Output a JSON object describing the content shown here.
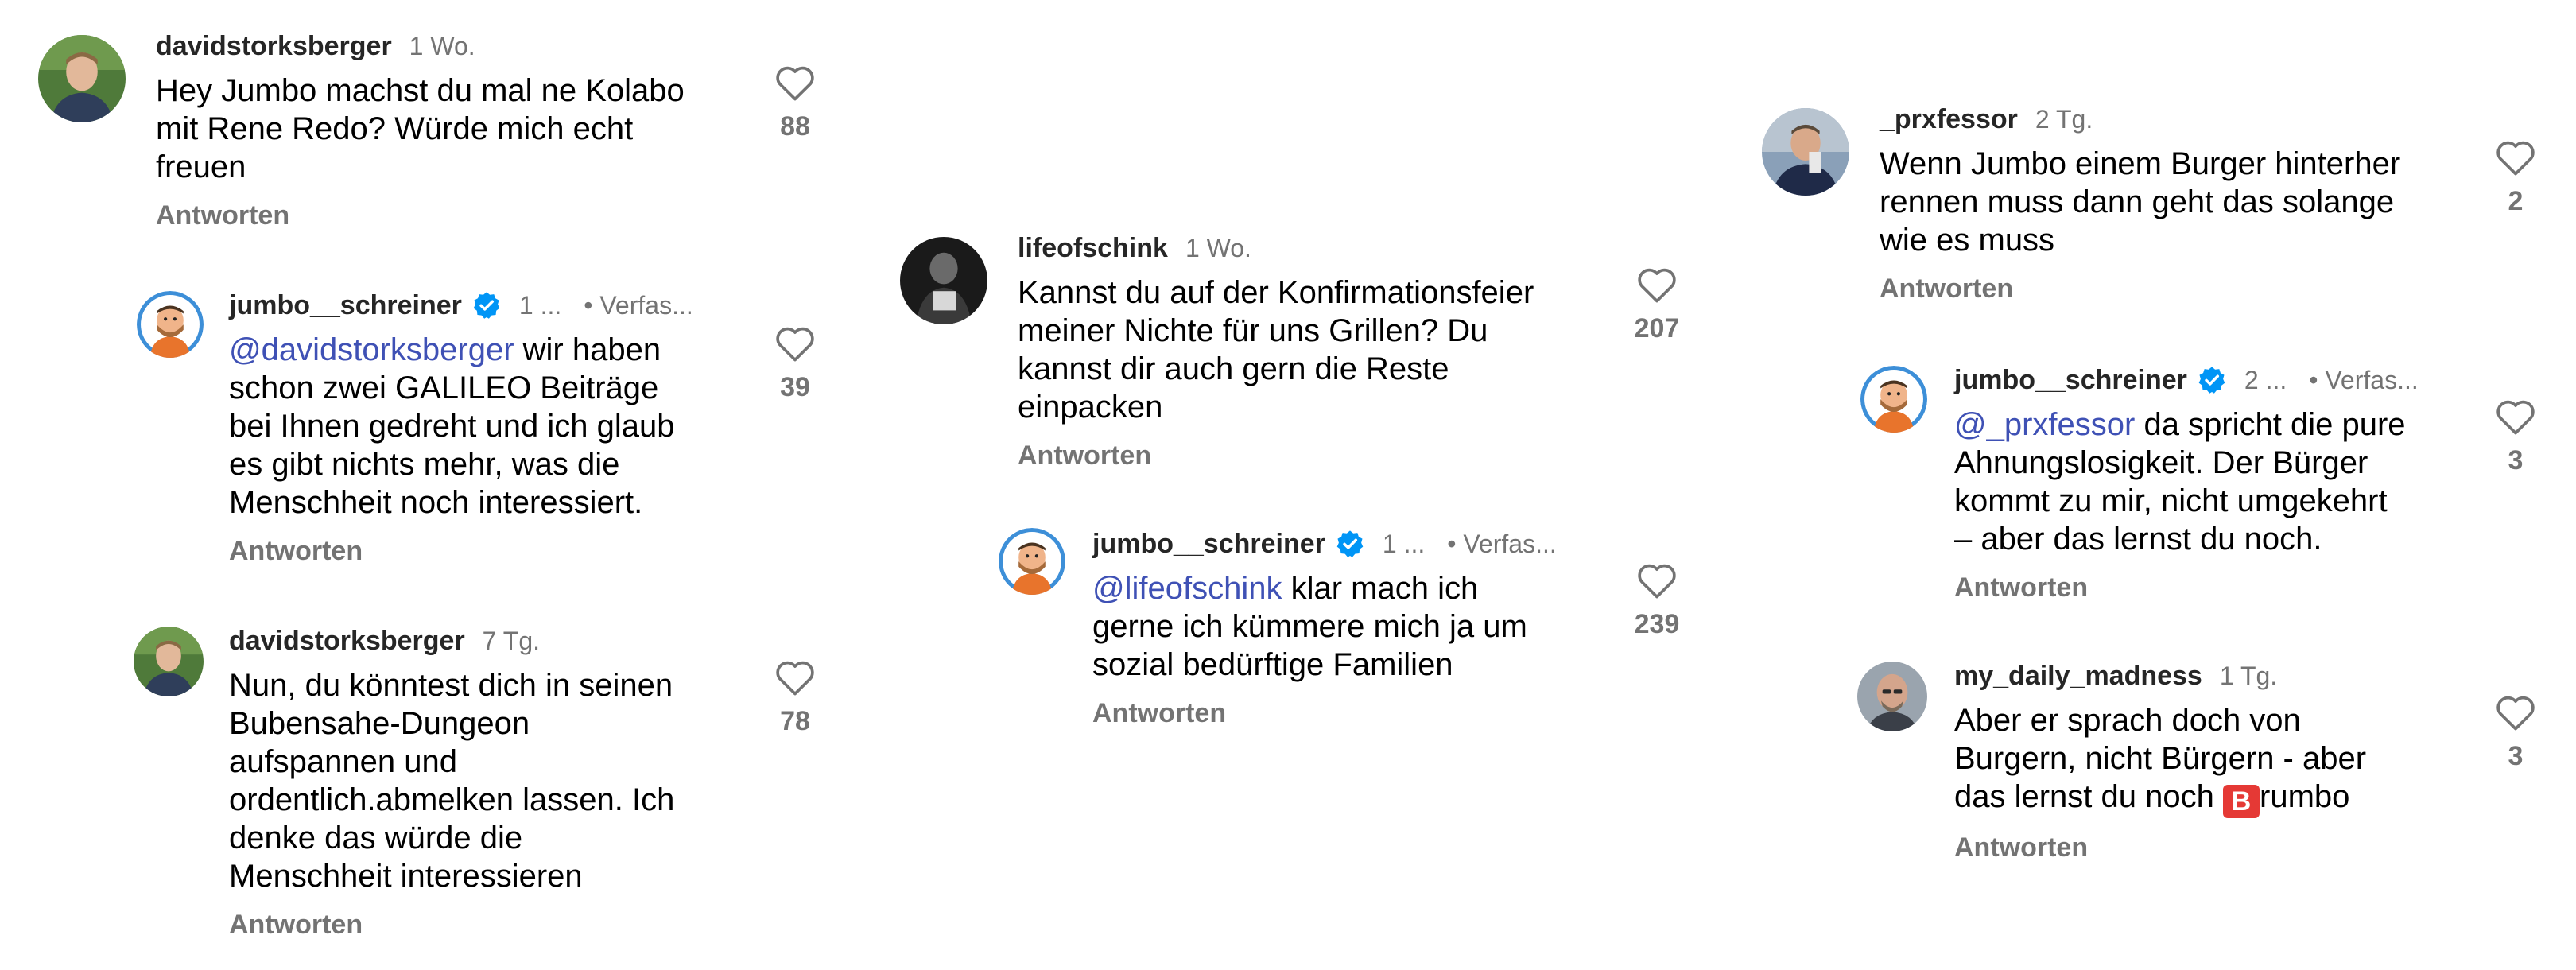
{
  "columns": [
    {
      "comments": [
        {
          "username": "davidstorksberger",
          "time": "1 Wo.",
          "author_label": "",
          "mention": "",
          "text_lines": [
            "Hey Jumbo machst du mal ne Kolabo",
            "mit Rene Redo? Würde mich echt",
            "freuen"
          ],
          "reply_label": "Antworten",
          "likes": "88",
          "avatar_icon": "profile-photo-young-man"
        },
        {
          "username": "jumbo__schreiner",
          "time": "1 ...",
          "author_label": "• Verfas...",
          "mention": "@davidstorksberger",
          "text_lines": [
            " wir haben",
            "schon zwei GALILEO Beiträge",
            "bei Ihnen gedreht und ich glaub",
            "es gibt nichts mehr, was die",
            "Menschheit noch interessiert."
          ],
          "reply_label": "Antworten",
          "likes": "39",
          "avatar_icon": "cartoon-chef-avatar"
        },
        {
          "username": "davidstorksberger",
          "time": "7 Tg.",
          "author_label": "",
          "mention": "",
          "text_lines": [
            "Nun, du könntest dich in seinen",
            "Bubensahe-Dungeon",
            "aufspannen und",
            "ordentlich.abmelken lassen. Ich",
            "denke das würde die",
            "Menschheit interessieren"
          ],
          "reply_label": "Antworten",
          "likes": "78",
          "avatar_icon": "profile-photo-young-man"
        }
      ]
    },
    {
      "comments": [
        {
          "username": "lifeofschink",
          "time": "1 Wo.",
          "author_label": "",
          "mention": "",
          "text_lines": [
            "Kannst du auf der Konfirmationsfeier",
            "meiner Nichte für uns Grillen? Du",
            "kannst dir auch gern die Reste",
            "einpacken"
          ],
          "reply_label": "Antworten",
          "likes": "207",
          "avatar_icon": "black-white-photo"
        },
        {
          "username": "jumbo__schreiner",
          "time": "1 ...",
          "author_label": "• Verfas...",
          "mention": "@lifeofschink",
          "text_lines": [
            " klar mach ich",
            "gerne ich kümmere mich ja um",
            "sozial bedürftige Familien"
          ],
          "reply_label": "Antworten",
          "likes": "239",
          "avatar_icon": "cartoon-chef-avatar"
        }
      ]
    },
    {
      "comments": [
        {
          "username": "_prxfessor",
          "time": "2 Tg.",
          "author_label": "",
          "mention": "",
          "text_lines": [
            "Wenn Jumbo einem Burger hinterher",
            "rennen muss dann geht das solange",
            "wie es muss"
          ],
          "reply_label": "Antworten",
          "likes": "2",
          "avatar_icon": "profile-photo-man-suit"
        },
        {
          "username": "jumbo__schreiner",
          "time": "2 ...",
          "author_label": "• Verfas...",
          "mention": "@_prxfessor",
          "text_lines": [
            " da spricht die pure",
            "Ahnungslosigkeit. Der Bürger",
            "kommt zu mir, nicht umgekehrt",
            "– aber das lernst du noch."
          ],
          "reply_label": "Antworten",
          "likes": "3",
          "avatar_icon": "cartoon-chef-avatar"
        },
        {
          "username": "my_daily_madness",
          "time": "1 Tg.",
          "author_label": "",
          "mention": "",
          "text_lines": [
            "Aber er sprach doch von",
            "Burgern, nicht Bürgern - aber",
            "das lernst du noch "
          ],
          "emoji_b": "🅱",
          "text_tail": "rumbo",
          "reply_label": "Antworten",
          "likes": "3",
          "avatar_icon": "profile-photo-bald-man"
        }
      ]
    }
  ],
  "colors": {
    "text": "#000000",
    "username": "#262626",
    "muted": "#737373",
    "mention": "#3f51b5",
    "verified": "#0095f6"
  }
}
